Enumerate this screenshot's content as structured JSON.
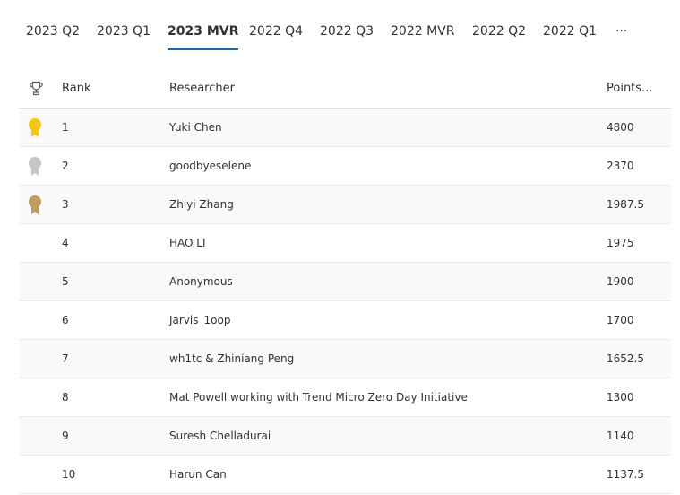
{
  "tabs": [
    {
      "label": "2023 Q2"
    },
    {
      "label": "2023 Q1"
    },
    {
      "label": "2023 MVR",
      "active": true
    },
    {
      "label": "2022 Q4"
    },
    {
      "label": "2022 Q3"
    },
    {
      "label": "2022 MVR"
    },
    {
      "label": "2022 Q2"
    },
    {
      "label": "2022 Q1"
    },
    {
      "label": "···"
    }
  ],
  "table": {
    "headers": {
      "icon": "trophy-icon",
      "rank": "Rank",
      "researcher": "Researcher",
      "points": "Points..."
    },
    "rows": [
      {
        "rank": "1",
        "researcher": "Yuki Chen",
        "points": "4800",
        "medal": "gold"
      },
      {
        "rank": "2",
        "researcher": "goodbyeselene",
        "points": "2370",
        "medal": "silver"
      },
      {
        "rank": "3",
        "researcher": "Zhiyi Zhang",
        "points": "1987.5",
        "medal": "bronze"
      },
      {
        "rank": "4",
        "researcher": "HAO LI",
        "points": "1975"
      },
      {
        "rank": "5",
        "researcher": "Anonymous",
        "points": "1900"
      },
      {
        "rank": "6",
        "researcher": "Jarvis_1oop",
        "points": "1700"
      },
      {
        "rank": "7",
        "researcher": "wh1tc & Zhiniang Peng",
        "points": "1652.5"
      },
      {
        "rank": "8",
        "researcher": "Mat Powell working with Trend Micro Zero Day Initiative",
        "points": "1300"
      },
      {
        "rank": "9",
        "researcher": "Suresh Chelladurai",
        "points": "1140"
      },
      {
        "rank": "10",
        "researcher": "Harun Can",
        "points": "1137.5"
      }
    ]
  },
  "colors": {
    "gold": "#f2c811",
    "silver": "#c8c6c4",
    "bronze": "#c19c5f",
    "accent": "#0f6cbd"
  }
}
